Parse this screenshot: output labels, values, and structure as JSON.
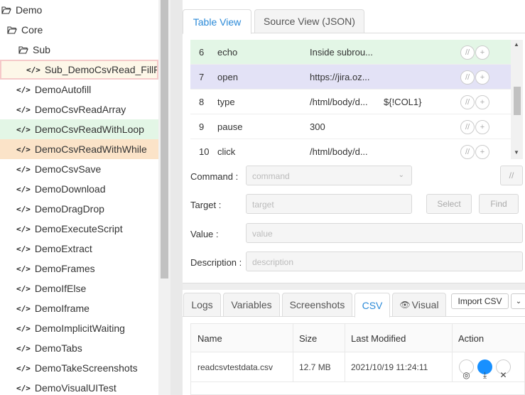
{
  "sidebar": {
    "items": [
      {
        "label": "Demo",
        "kind": "folder-open",
        "depth": 0
      },
      {
        "label": "Core",
        "kind": "folder-open",
        "depth": 1
      },
      {
        "label": "Sub",
        "kind": "folder-open",
        "depth": 2
      },
      {
        "label": "Sub_DemoCsvRead_FillForm",
        "kind": "macro",
        "depth": 3,
        "state": "selected"
      },
      {
        "label": "DemoAutofill",
        "kind": "macro",
        "depth": 2
      },
      {
        "label": "DemoCsvReadArray",
        "kind": "macro",
        "depth": 2
      },
      {
        "label": "DemoCsvReadWithLoop",
        "kind": "macro",
        "depth": 2,
        "state": "green"
      },
      {
        "label": "DemoCsvReadWithWhile",
        "kind": "macro",
        "depth": 2,
        "state": "orange"
      },
      {
        "label": "DemoCsvSave",
        "kind": "macro",
        "depth": 2
      },
      {
        "label": "DemoDownload",
        "kind": "macro",
        "depth": 2
      },
      {
        "label": "DemoDragDrop",
        "kind": "macro",
        "depth": 2
      },
      {
        "label": "DemoExecuteScript",
        "kind": "macro",
        "depth": 2
      },
      {
        "label": "DemoExtract",
        "kind": "macro",
        "depth": 2
      },
      {
        "label": "DemoFrames",
        "kind": "macro",
        "depth": 2
      },
      {
        "label": "DemoIfElse",
        "kind": "macro",
        "depth": 2
      },
      {
        "label": "DemoIframe",
        "kind": "macro",
        "depth": 2
      },
      {
        "label": "DemoImplicitWaiting",
        "kind": "macro",
        "depth": 2
      },
      {
        "label": "DemoTabs",
        "kind": "macro",
        "depth": 2
      },
      {
        "label": "DemoTakeScreenshots",
        "kind": "macro",
        "depth": 2
      },
      {
        "label": "DemoVisualUITest",
        "kind": "macro",
        "depth": 2
      }
    ],
    "macro_code_glyph": "</>"
  },
  "top_tabs": {
    "table_view": "Table View",
    "source_view": "Source View (JSON)"
  },
  "commands": [
    {
      "num": "6",
      "cmd": "echo",
      "target": "Inside subrou...",
      "value": "",
      "state": "green"
    },
    {
      "num": "7",
      "cmd": "open",
      "target": "https://jira.oz...",
      "value": "",
      "state": "purple"
    },
    {
      "num": "8",
      "cmd": "type",
      "target": "/html/body/d...",
      "value": "${!COL1}",
      "state": ""
    },
    {
      "num": "9",
      "cmd": "pause",
      "target": "300",
      "value": "",
      "state": ""
    },
    {
      "num": "10",
      "cmd": "click",
      "target": "/html/body/d...",
      "value": "",
      "state": ""
    }
  ],
  "row_buttons": {
    "comment": "//",
    "add": "+"
  },
  "form": {
    "command_label": "Command :",
    "command_placeholder": "command",
    "comment_btn": "//",
    "target_label": "Target :",
    "target_placeholder": "target",
    "select_btn": "Select",
    "find_btn": "Find",
    "value_label": "Value :",
    "value_placeholder": "value",
    "description_label": "Description :",
    "description_placeholder": "description"
  },
  "bottom_tabs": {
    "logs": "Logs",
    "variables": "Variables",
    "screenshots": "Screenshots",
    "csv": "CSV",
    "visual": "Visual",
    "import_csv": "Import CSV"
  },
  "csv_table": {
    "headers": {
      "name": "Name",
      "size": "Size",
      "modified": "Last Modified",
      "action": "Action"
    },
    "rows": [
      {
        "name": "readcsvtestdata.csv",
        "size": "12.7 MB",
        "modified": "2021/10/19 11:24:11"
      }
    ]
  },
  "colors": {
    "accent": "#2b8ad8",
    "row_green": "#e3f6e6",
    "row_purple": "#e3e2f6",
    "row_orange": "#fbe3c8",
    "download_blue": "#1890ff"
  }
}
